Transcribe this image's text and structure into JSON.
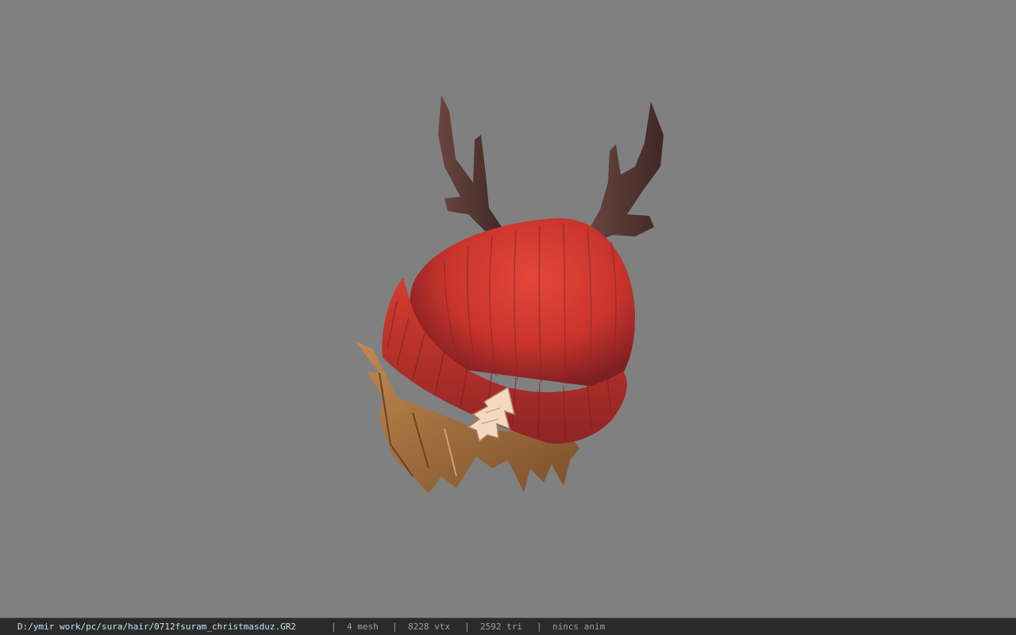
{
  "viewer": {
    "background_color": "#808080",
    "model": {
      "description_icon": "reindeer-beanie-hair-model",
      "colors": {
        "hat": "#c8342c",
        "antlers": "#5a3a34",
        "hair": "#9a6a3a",
        "tree_badge": "#f2d9c0"
      }
    }
  },
  "status_bar": {
    "file_path": "D:/ymir work/pc/sura/hair/0712fsuram_christmasduz.GR2",
    "separator": "|",
    "mesh": "4 mesh",
    "vtx": "8228 vtx",
    "tri": "2592 tri",
    "anim": "nincs anim"
  }
}
